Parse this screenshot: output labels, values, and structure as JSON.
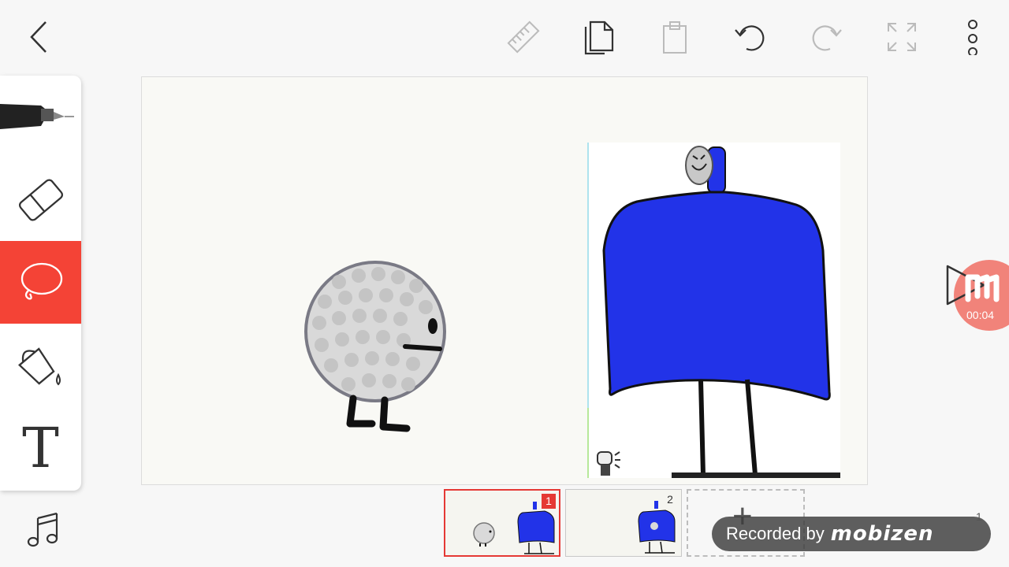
{
  "toolbar": {
    "icons": [
      "back-arrow-icon",
      "ruler-icon",
      "copy-icon",
      "paste-icon",
      "undo-icon",
      "redo-icon",
      "fullscreen-icon",
      "more-vertical-icon"
    ]
  },
  "tools": {
    "active": "lasso",
    "items": [
      "pen",
      "eraser",
      "lasso",
      "fill",
      "text"
    ]
  },
  "text_tool_glyph": "T",
  "colors": {
    "accent": "#f44336",
    "character_blue": "#2233e8",
    "golf_ball": "#d9d9d9"
  },
  "frames": [
    {
      "number": "1",
      "selected": true
    },
    {
      "number": "2",
      "selected": false
    }
  ],
  "add_frame_glyph": "+",
  "recorder": {
    "time": "00:04",
    "watermark_prefix": "Recorded by",
    "watermark_brand": "mobizen"
  },
  "corner_number": "1"
}
